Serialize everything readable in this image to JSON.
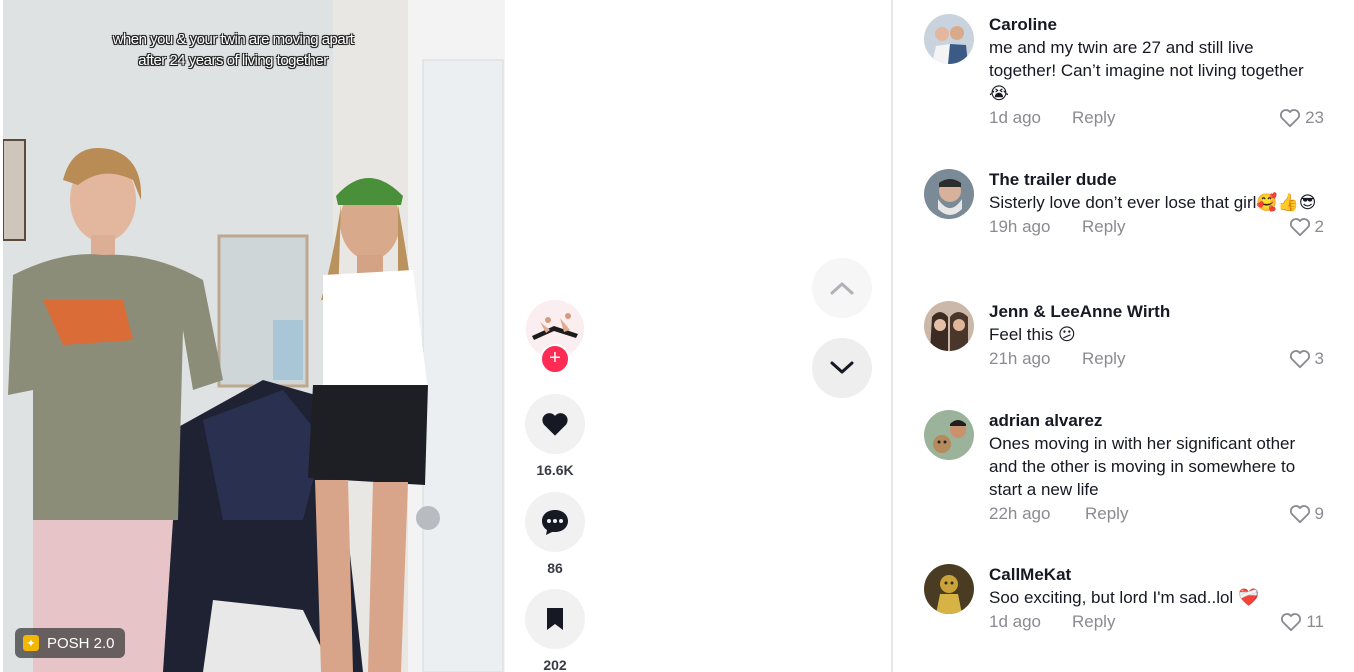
{
  "video": {
    "caption": "when you & your twin are moving apart after 24 years of living together",
    "badge": "POSH 2.0"
  },
  "actions": {
    "likes": "16.6K",
    "comments": "86",
    "saves": "202"
  },
  "colors": {
    "accent": "#fe2c55",
    "muted": "#8a8b91",
    "text": "#161823"
  },
  "comments": [
    {
      "user": "Caroline",
      "text": "me and my twin are 27 and still live together! Can’t imagine not living together",
      "emoji": "😭",
      "time": "1d ago",
      "reply": "Reply",
      "likes": "23"
    },
    {
      "user": "The trailer dude",
      "text": "Sisterly love don’t ever lose that girl",
      "emoji": "🥰👍😎",
      "time": "19h ago",
      "reply": "Reply",
      "likes": "2"
    },
    {
      "user": "Jenn & LeeAnne Wirth",
      "text": "Feel this",
      "emoji": "😕",
      "time": "21h ago",
      "reply": "Reply",
      "likes": "3"
    },
    {
      "user": "adrian alvarez",
      "text": "Ones moving in with her significant other and the other is moving in somewhere to start a new life",
      "emoji": "",
      "time": "22h ago",
      "reply": "Reply",
      "likes": "9"
    },
    {
      "user": "CallMeKat",
      "text": "Soo exciting, but lord I'm sad..lol",
      "emoji": "❤️‍🩹",
      "time": "1d ago",
      "reply": "Reply",
      "likes": "11"
    }
  ]
}
